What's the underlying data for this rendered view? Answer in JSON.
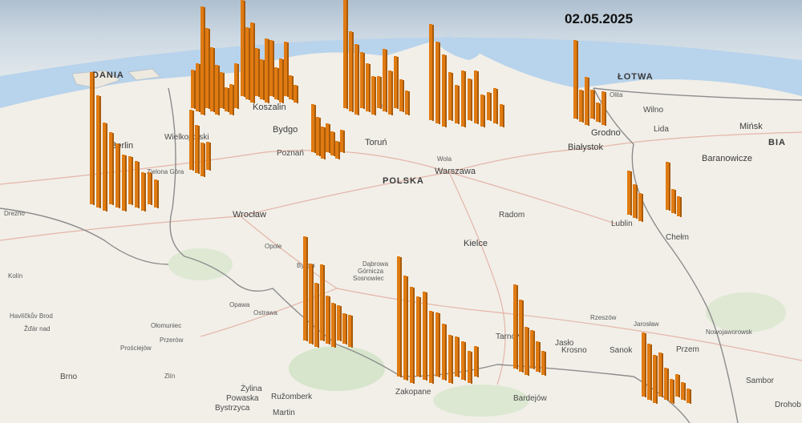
{
  "date": "02.05.2025",
  "colors": {
    "bar": "#e07b12",
    "bar_shade": "#a85a0a",
    "water": "#b8d3ec",
    "land": "#f1efe8",
    "border": "#8a8a8a"
  },
  "labels": [
    {
      "id": "dania",
      "text": "DANIA",
      "cls": "country"
    },
    {
      "id": "lotwa",
      "text": "ŁOTWA",
      "cls": "country"
    },
    {
      "id": "polska",
      "text": "POLSKA",
      "cls": "country"
    },
    {
      "id": "bial",
      "text": "BIA",
      "cls": "country"
    },
    {
      "id": "koszalin",
      "text": "Koszalin",
      "cls": "big"
    },
    {
      "id": "bydgoszcz",
      "text": "Bydgo",
      "cls": "big"
    },
    {
      "id": "torun",
      "text": "Toruń",
      "cls": "big"
    },
    {
      "id": "poznan",
      "text": "Poznań",
      "cls": "med"
    },
    {
      "id": "warszawa",
      "text": "Warszawa",
      "cls": "big"
    },
    {
      "id": "bialystok",
      "text": "Białystok",
      "cls": "big"
    },
    {
      "id": "grodno",
      "text": "Grodno",
      "cls": "big"
    },
    {
      "id": "lida",
      "text": "Lida",
      "cls": "med"
    },
    {
      "id": "wilno",
      "text": "Wilno",
      "cls": "med"
    },
    {
      "id": "minsk",
      "text": "Mińsk",
      "cls": "big"
    },
    {
      "id": "baranowicze",
      "text": "Baranowicze",
      "cls": "big"
    },
    {
      "id": "berlin",
      "text": "Berlin",
      "cls": "big"
    },
    {
      "id": "wielkopolski",
      "text": "Wielkopolski",
      "cls": "med"
    },
    {
      "id": "zielona",
      "text": "Zielona Góra",
      "cls": "sm"
    },
    {
      "id": "wroclaw",
      "text": "Wrocław",
      "cls": "big"
    },
    {
      "id": "opole",
      "text": "Opole",
      "cls": "sm"
    },
    {
      "id": "radom",
      "text": "Radom",
      "cls": "med"
    },
    {
      "id": "kielce",
      "text": "Kielce",
      "cls": "big"
    },
    {
      "id": "lublin",
      "text": "Lublin",
      "cls": "med"
    },
    {
      "id": "chelm",
      "text": "Chełm",
      "cls": "med"
    },
    {
      "id": "bytom",
      "text": "Bytom",
      "cls": "sm"
    },
    {
      "id": "dabrowa",
      "text": "Dąbrowa",
      "cls": "sm"
    },
    {
      "id": "gornicza",
      "text": "Górnicza",
      "cls": "sm"
    },
    {
      "id": "sosnowiec",
      "text": "Sosnowiec",
      "cls": "sm"
    },
    {
      "id": "tarnow",
      "text": "Tarnów",
      "cls": "med"
    },
    {
      "id": "rzeszow",
      "text": "Rzeszów",
      "cls": "sm"
    },
    {
      "id": "jaslo",
      "text": "Jasło",
      "cls": "med"
    },
    {
      "id": "krosno",
      "text": "Krosno",
      "cls": "med"
    },
    {
      "id": "sanok",
      "text": "Sanok",
      "cls": "med"
    },
    {
      "id": "przemysl",
      "text": "Przem",
      "cls": "med"
    },
    {
      "id": "zakopane",
      "text": "Zakopane",
      "cls": "med"
    },
    {
      "id": "opawa",
      "text": "Opawa",
      "cls": "sm"
    },
    {
      "id": "ostrawa",
      "text": "Ostrawa",
      "cls": "sm"
    },
    {
      "id": "olomuniec",
      "text": "Ołomuniec",
      "cls": "sm"
    },
    {
      "id": "przerow",
      "text": "Przerów",
      "cls": "sm"
    },
    {
      "id": "zlin",
      "text": "Zlín",
      "cls": "sm"
    },
    {
      "id": "brno",
      "text": "Brno",
      "cls": "med"
    },
    {
      "id": "zylina",
      "text": "Żylina",
      "cls": "med"
    },
    {
      "id": "ruzomberk",
      "text": "Ružomberk",
      "cls": "med"
    },
    {
      "id": "martin",
      "text": "Martin",
      "cls": "med"
    },
    {
      "id": "bystrzyca",
      "text": "Bystrzyca",
      "cls": "med"
    },
    {
      "id": "powaska",
      "text": "Powaska",
      "cls": "med"
    },
    {
      "id": "bardejow",
      "text": "Bardejów",
      "cls": "med"
    },
    {
      "id": "sambor",
      "text": "Sambor",
      "cls": "med"
    },
    {
      "id": "drohobycz",
      "text": "Drohob",
      "cls": "med"
    },
    {
      "id": "nowojaworowsk",
      "text": "Nowojaworowsk",
      "cls": "sm"
    },
    {
      "id": "jaroslaw",
      "text": "Jarosław",
      "cls": "sm"
    },
    {
      "id": "dresden",
      "text": "Drezno",
      "cls": "sm"
    },
    {
      "id": "kolin",
      "text": "Kolín",
      "cls": "sm"
    },
    {
      "id": "havlickuv",
      "text": "Havlíčkův Brod",
      "cls": "sm"
    },
    {
      "id": "zdar",
      "text": "Žďár nad",
      "cls": "sm"
    },
    {
      "id": "prostejow",
      "text": "Prościejów",
      "cls": "sm"
    },
    {
      "id": "wola",
      "text": "Wola",
      "cls": "sm"
    },
    {
      "id": "gdansk",
      "text": "ńsk",
      "cls": "sm"
    },
    {
      "id": "olita",
      "text": "Olita",
      "cls": "sm"
    }
  ],
  "bar_clusters": [
    {
      "name": "pomorze-zachodnie",
      "heights": [
        48,
        60,
        135,
        100,
        80,
        62,
        45,
        30,
        38,
        56
      ]
    },
    {
      "name": "koszalin",
      "heights": [
        120,
        90,
        100,
        60,
        50,
        80,
        70,
        40,
        55,
        68,
        30,
        22
      ]
    },
    {
      "name": "gdansk",
      "heights": [
        140,
        100,
        88,
        70,
        60,
        48,
        40,
        78,
        55,
        65,
        40,
        30
      ]
    },
    {
      "name": "mazury",
      "heights": [
        120,
        102,
        90,
        60,
        48,
        70,
        52,
        66,
        40,
        35,
        44,
        28
      ]
    },
    {
      "name": "podlasie",
      "heights": [
        98,
        40,
        60,
        36,
        24,
        42
      ]
    },
    {
      "name": "bydgoszcz",
      "heights": [
        60,
        48,
        40,
        36,
        30,
        22,
        28
      ]
    },
    {
      "name": "lubuskie",
      "heights": [
        75,
        60,
        42,
        35
      ]
    },
    {
      "name": "dolny-slask",
      "heights": [
        165,
        140,
        110,
        90,
        80,
        70,
        60,
        58,
        48,
        40,
        35
      ]
    },
    {
      "name": "slask",
      "heights": [
        130,
        100,
        80,
        95,
        60,
        55,
        44,
        38,
        40
      ]
    },
    {
      "name": "malopolska",
      "heights": [
        150,
        130,
        120,
        100,
        110,
        90,
        80,
        70,
        60,
        50,
        48,
        40,
        38
      ]
    },
    {
      "name": "tarnow",
      "heights": [
        105,
        90,
        60,
        48,
        38,
        30
      ]
    },
    {
      "name": "lublin",
      "heights": [
        55,
        42,
        35
      ]
    },
    {
      "name": "podkarpacie",
      "heights": [
        80,
        70,
        60,
        55,
        40,
        30,
        28,
        22,
        18
      ]
    },
    {
      "name": "wschod",
      "heights": [
        60,
        30,
        25
      ]
    }
  ]
}
